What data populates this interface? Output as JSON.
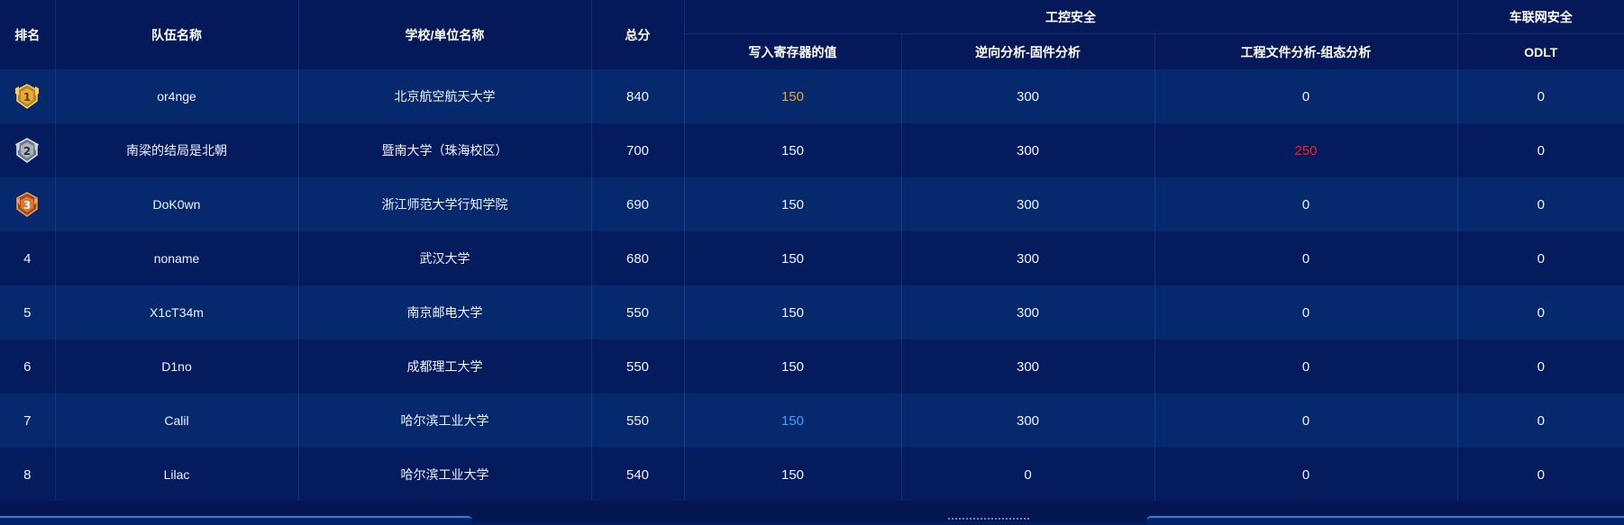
{
  "header": {
    "rank": "排名",
    "team": "队伍名称",
    "school": "学校/单位名称",
    "total": "总分",
    "group_ics": "工控安全",
    "group_iov": "车联网安全",
    "challenges": [
      "写入寄存器的值",
      "逆向分析-固件分析",
      "工程文件分析-组态分析",
      "ODLT"
    ]
  },
  "rows": [
    {
      "rank": "1",
      "team": "or4nge",
      "school": "北京航空航天大学",
      "total": "840",
      "scores": [
        "150",
        "300",
        "0",
        "0"
      ]
    },
    {
      "rank": "2",
      "team": "南梁的结局是北朝",
      "school": "暨南大学（珠海校区）",
      "total": "700",
      "scores": [
        "150",
        "300",
        "250",
        "0"
      ]
    },
    {
      "rank": "3",
      "team": "DoK0wn",
      "school": "浙江师范大学行知学院",
      "total": "690",
      "scores": [
        "150",
        "300",
        "0",
        "0"
      ]
    },
    {
      "rank": "4",
      "team": "noname",
      "school": "武汉大学",
      "total": "680",
      "scores": [
        "150",
        "300",
        "0",
        "0"
      ]
    },
    {
      "rank": "5",
      "team": "X1cT34m",
      "school": "南京邮电大学",
      "total": "550",
      "scores": [
        "150",
        "300",
        "0",
        "0"
      ]
    },
    {
      "rank": "6",
      "team": "D1no",
      "school": "成都理工大学",
      "total": "550",
      "scores": [
        "150",
        "300",
        "0",
        "0"
      ]
    },
    {
      "rank": "7",
      "team": "Calil",
      "school": "哈尔滨工业大学",
      "total": "550",
      "scores": [
        "150",
        "300",
        "0",
        "0"
      ]
    },
    {
      "rank": "8",
      "team": "Lilac",
      "school": "哈尔滨工业大学",
      "total": "540",
      "scores": [
        "150",
        "0",
        "0",
        "0"
      ]
    }
  ],
  "highlights": {
    "first_blood_color": "#f0a030",
    "red_color": "#ff1f1f",
    "blue_color": "#3fa0ff"
  },
  "icons": {
    "rank1": "gold-medal-icon",
    "rank2": "silver-medal-icon",
    "rank3": "bronze-medal-icon"
  }
}
